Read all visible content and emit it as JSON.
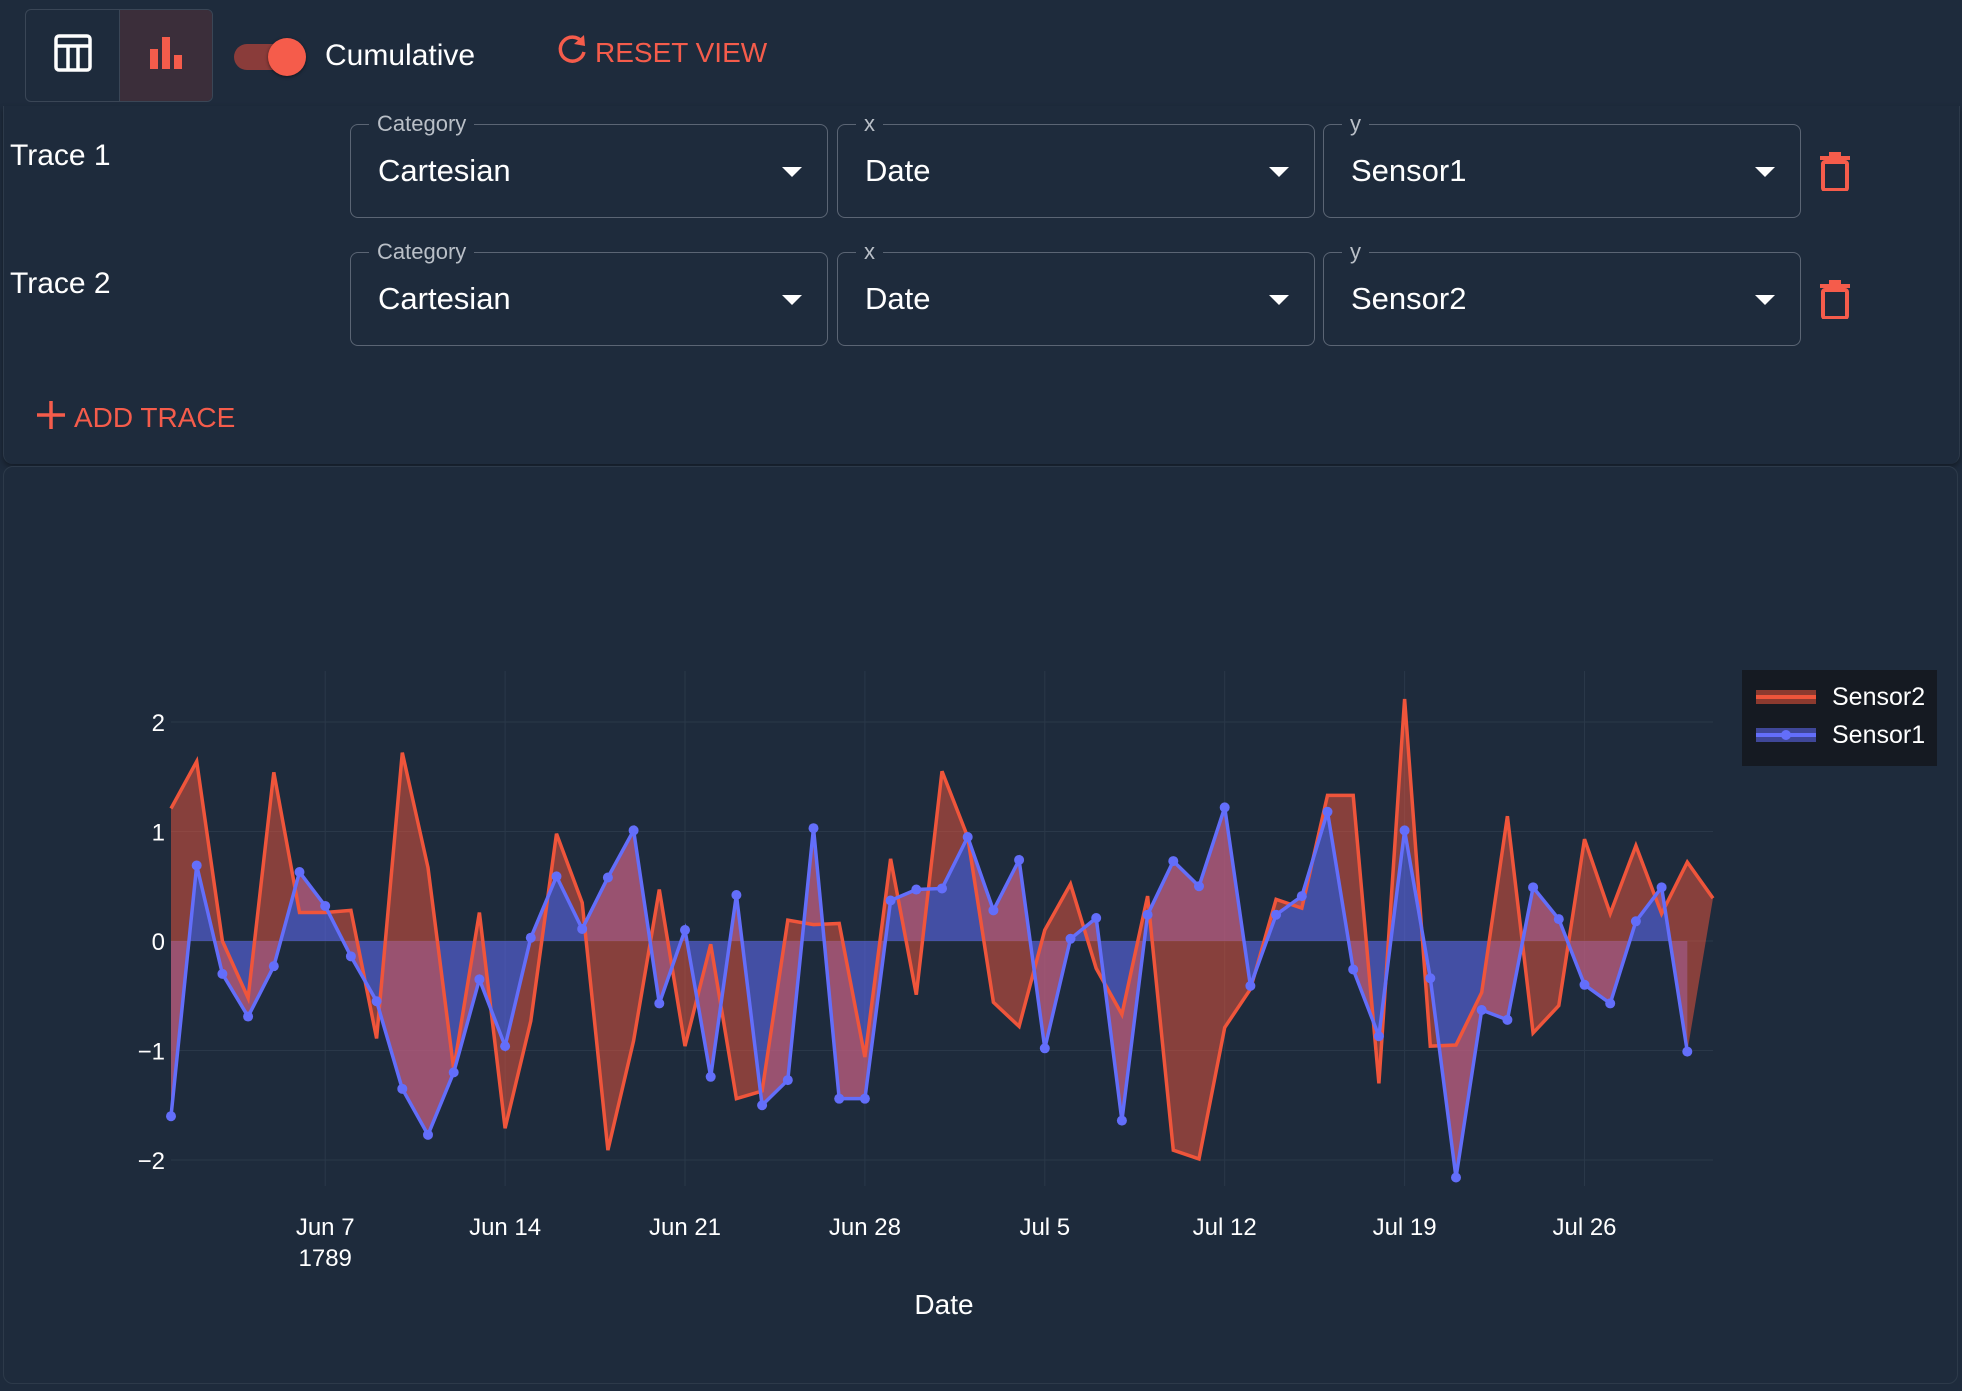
{
  "toolbar": {
    "view_buttons": [
      {
        "icon": "table-icon",
        "active": false
      },
      {
        "icon": "bar-chart-icon",
        "active": true
      }
    ],
    "cumulative": {
      "label": "Cumulative",
      "on": true
    },
    "reset_label": "RESET VIEW"
  },
  "traces": [
    {
      "label": "Trace 1",
      "category_label": "Category",
      "category": "Cartesian",
      "x_label": "x",
      "x": "Date",
      "y_label": "y",
      "y": "Sensor1"
    },
    {
      "label": "Trace 2",
      "category_label": "Category",
      "category": "Cartesian",
      "x_label": "x",
      "x": "Date",
      "y_label": "y",
      "y": "Sensor2"
    }
  ],
  "add_trace_label": "ADD TRACE",
  "colors": {
    "accent": "#f55c4b",
    "sensor1": "#636efa",
    "sensor2": "#ef553b",
    "background": "#1e2b3c",
    "legend_bg": "#151a22"
  },
  "chart_data": {
    "type": "area",
    "title": "",
    "xlabel": "Date",
    "ylabel": "",
    "x_start": "1789-06-01",
    "x_ticks": [
      "Jun 7",
      "Jun 14",
      "Jun 21",
      "Jun 28",
      "Jul 5",
      "Jul 12",
      "Jul 19",
      "Jul 26"
    ],
    "x_tick_year": "1789",
    "y_ticks": [
      "2",
      "1",
      "0",
      "−1",
      "−2"
    ],
    "ylim": [
      -2.4,
      2.5
    ],
    "grid": true,
    "legend_position": "top-right",
    "legend": [
      "Sensor2",
      "Sensor1"
    ],
    "series": [
      {
        "name": "Sensor1",
        "mode": "lines+markers",
        "fill": "tozeroy",
        "values": [
          -1.6,
          0.69,
          -0.3,
          -0.69,
          -0.23,
          0.63,
          0.32,
          -0.14,
          -0.55,
          -1.35,
          -1.77,
          -1.2,
          -0.35,
          -0.96,
          0.03,
          0.59,
          0.11,
          0.58,
          1.01,
          -0.57,
          0.1,
          -1.24,
          0.42,
          -1.5,
          -1.27,
          1.03,
          -1.44,
          -1.44,
          0.37,
          0.47,
          0.48,
          0.95,
          0.28,
          0.74,
          -0.98,
          0.02,
          0.21,
          -1.64,
          0.24,
          0.73,
          0.5,
          1.22,
          -0.41,
          0.24,
          0.41,
          1.18,
          -0.26,
          -0.87,
          1.01,
          -0.34,
          -2.16,
          -0.63,
          -0.72,
          0.49,
          0.2,
          -0.4,
          -0.57,
          0.18,
          0.49,
          -1.01
        ]
      },
      {
        "name": "Sensor2",
        "mode": "lines",
        "fill": "tonexty",
        "values": [
          1.21,
          1.64,
          0.0,
          -0.52,
          1.54,
          0.26,
          0.26,
          0.28,
          -0.89,
          1.72,
          0.67,
          -1.17,
          0.26,
          -1.71,
          -0.73,
          0.98,
          0.35,
          -1.91,
          -0.91,
          0.47,
          -0.96,
          -0.03,
          -1.44,
          -1.37,
          0.19,
          0.15,
          0.16,
          -1.06,
          0.75,
          -0.49,
          1.55,
          0.95,
          -0.56,
          -0.78,
          0.1,
          0.52,
          -0.25,
          -0.67,
          0.41,
          -1.91,
          -1.99,
          -0.79,
          -0.44,
          0.38,
          0.3,
          1.33,
          1.33,
          -1.3,
          2.21,
          -0.96,
          -0.95,
          -0.47,
          1.14,
          -0.84,
          -0.59,
          0.93,
          0.25,
          0.87,
          0.25,
          0.72,
          0.39
        ]
      }
    ]
  }
}
